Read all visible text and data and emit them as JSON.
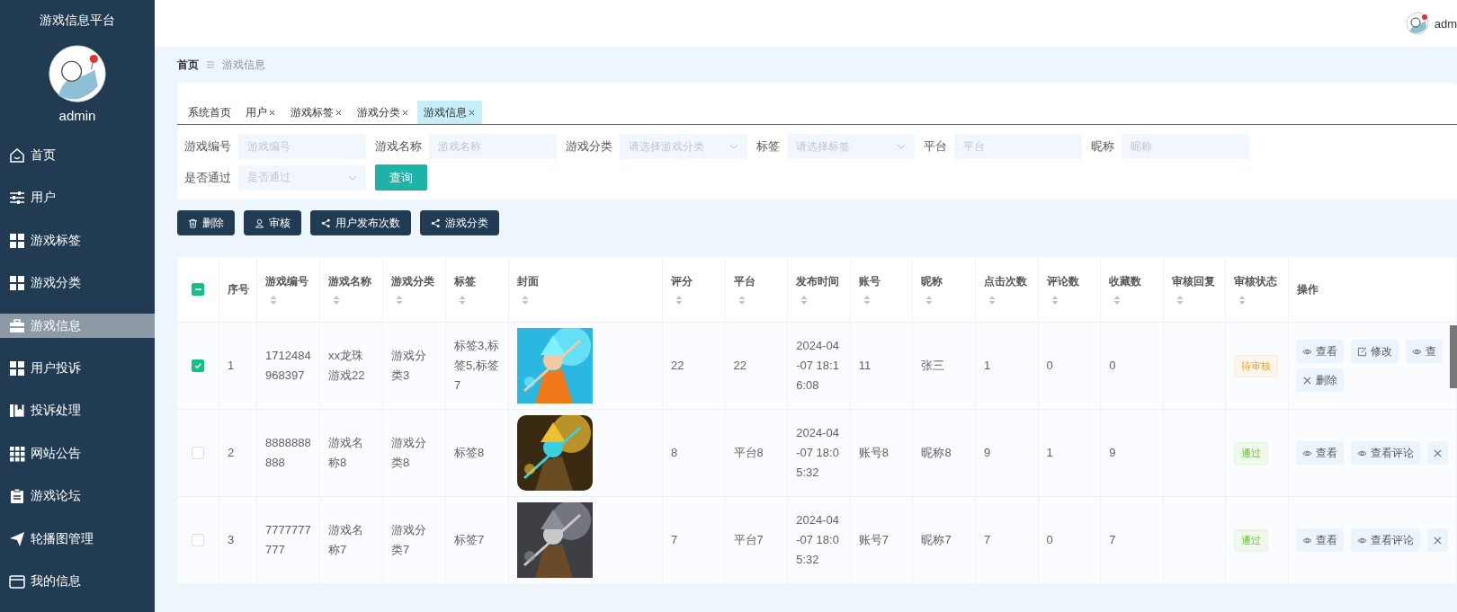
{
  "sidebar": {
    "title": "游戏信息平台",
    "user_name": "admin",
    "items": [
      {
        "label": "首页",
        "selected": false
      },
      {
        "label": "用户",
        "selected": false
      },
      {
        "label": "游戏标签",
        "selected": false
      },
      {
        "label": "游戏分类",
        "selected": false
      },
      {
        "label": "游戏信息",
        "selected": true
      },
      {
        "label": "用户投诉",
        "selected": false
      },
      {
        "label": "投诉处理",
        "selected": false
      },
      {
        "label": "网站公告",
        "selected": false
      },
      {
        "label": "游戏论坛",
        "selected": false
      },
      {
        "label": "轮播图管理",
        "selected": false
      },
      {
        "label": "我的信息",
        "selected": false
      }
    ]
  },
  "header": {
    "user_name": "adm"
  },
  "breadcrumb": [
    "首页",
    "游戏信息"
  ],
  "tabs": [
    {
      "label": "系统首页",
      "closable": false,
      "selected": false
    },
    {
      "label": "用户",
      "closable": true,
      "selected": false
    },
    {
      "label": "游戏标签",
      "closable": true,
      "selected": false
    },
    {
      "label": "游戏分类",
      "closable": true,
      "selected": false
    },
    {
      "label": "游戏信息",
      "closable": true,
      "selected": true
    }
  ],
  "filters": [
    {
      "label": "游戏编号",
      "placeholder": "游戏编号",
      "kind": "input"
    },
    {
      "label": "游戏名称",
      "placeholder": "游戏名称",
      "kind": "input"
    },
    {
      "label": "游戏分类",
      "placeholder": "请选择游戏分类",
      "kind": "select"
    },
    {
      "label": "标签",
      "placeholder": "请选择标签",
      "kind": "select"
    },
    {
      "label": "平台",
      "placeholder": "平台",
      "kind": "input"
    },
    {
      "label": "昵称",
      "placeholder": "昵称",
      "kind": "input"
    },
    {
      "label": "是否通过",
      "placeholder": "是否通过",
      "kind": "select"
    }
  ],
  "search_button": "查询",
  "actions": [
    {
      "label": "删除",
      "kind": "delete"
    },
    {
      "label": "审核",
      "kind": "audit"
    },
    {
      "label": "用户发布次数",
      "kind": "share"
    },
    {
      "label": "游戏分类",
      "kind": "share"
    }
  ],
  "table": {
    "select_all": {
      "indeterminate": true
    },
    "columns": [
      {
        "label": "序号",
        "sortable": false
      },
      {
        "label": "游戏编号",
        "sortable": true
      },
      {
        "label": "游戏名称",
        "sortable": true
      },
      {
        "label": "游戏分类",
        "sortable": true
      },
      {
        "label": "标签",
        "sortable": true
      },
      {
        "label": "封面",
        "sortable": true
      },
      {
        "label": "评分",
        "sortable": true
      },
      {
        "label": "平台",
        "sortable": true
      },
      {
        "label": "发布时间",
        "sortable": true
      },
      {
        "label": "账号",
        "sortable": true
      },
      {
        "label": "昵称",
        "sortable": true
      },
      {
        "label": "点击次数",
        "sortable": true
      },
      {
        "label": "评论数",
        "sortable": true
      },
      {
        "label": "收藏数",
        "sortable": true
      },
      {
        "label": "审核回复",
        "sortable": true
      },
      {
        "label": "审核状态",
        "sortable": true
      },
      {
        "label": "操作",
        "sortable": false
      }
    ],
    "rows": [
      {
        "checked": true,
        "cells": [
          "1",
          "1712484968397",
          "xx龙珠游戏22",
          "游戏分类3",
          "标签3,标签5,标签7"
        ],
        "cover": {
          "kind": "picture"
        },
        "cells2": [
          "22",
          "22",
          "2024-04-07 18:16:08",
          "11",
          "张三",
          "1",
          "0",
          "0"
        ],
        "status": {
          "label": "待审核",
          "kind": "pending"
        },
        "ops": [
          {
            "label": "查看",
            "kind": "view"
          },
          {
            "label": "修改",
            "kind": "edit"
          },
          {
            "label": "查",
            "kind": "view"
          },
          {
            "label": "删除",
            "kind": "delete"
          }
        ]
      },
      {
        "checked": false,
        "cells": [
          "2",
          "8888888888",
          "游戏名称8",
          "游戏分类8",
          "标签8"
        ],
        "cover": {
          "kind": "picture"
        },
        "cells2": [
          "8",
          "平台8",
          "2024-04-07 18:05:32",
          "账号8",
          "昵称8",
          "9",
          "1",
          "9"
        ],
        "status": {
          "label": "通过",
          "kind": "passed"
        },
        "ops": [
          {
            "label": "查看",
            "kind": "view"
          },
          {
            "label": "查看评论",
            "kind": "view"
          },
          {
            "kind": "delete"
          }
        ]
      },
      {
        "checked": false,
        "cells": [
          "3",
          "7777777777",
          "游戏名称7",
          "游戏分类7",
          "标签7"
        ],
        "cover": {
          "kind": "picture"
        },
        "cells2": [
          "7",
          "平台7",
          "2024-04-07 18:05:32",
          "账号7",
          "昵称7",
          "7",
          "0",
          "7"
        ],
        "status": {
          "label": "通过",
          "kind": "passed"
        },
        "ops": [
          {
            "label": "查看",
            "kind": "view"
          },
          {
            "label": "查看评论",
            "kind": "view"
          },
          {
            "kind": "delete"
          }
        ]
      }
    ]
  }
}
